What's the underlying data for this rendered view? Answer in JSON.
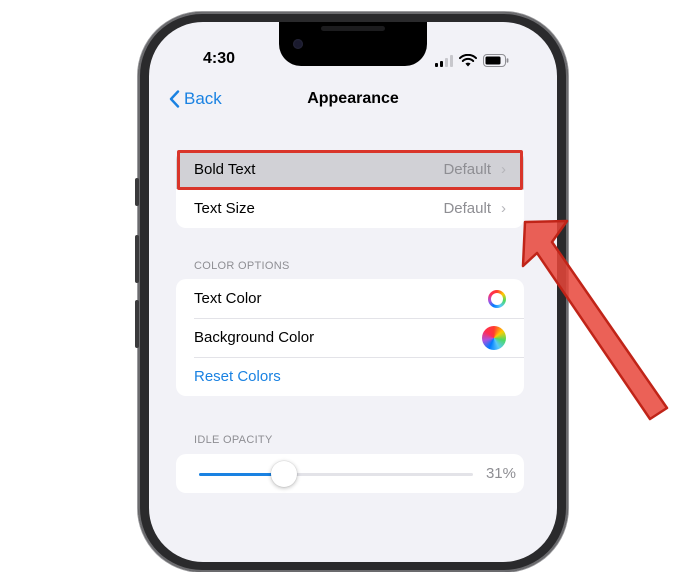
{
  "status_bar": {
    "time": "4:30"
  },
  "nav": {
    "back_label": "Back",
    "title": "Appearance"
  },
  "text_group": {
    "rows": [
      {
        "label": "Bold Text",
        "value": "Default"
      },
      {
        "label": "Text Size",
        "value": "Default"
      }
    ]
  },
  "color_options": {
    "header": "COLOR OPTIONS",
    "text_color_label": "Text Color",
    "background_color_label": "Background Color",
    "reset_label": "Reset Colors"
  },
  "idle_opacity": {
    "header": "IDLE OPACITY",
    "value_percent": 31,
    "value_label": "31%"
  },
  "colors": {
    "accent": "#1a82e2",
    "annotation_red": "#d9352a",
    "highlight_row": "#d1d1d6",
    "background": "#f2f2f7"
  },
  "icons": [
    "chevron-left-icon",
    "chevron-right-icon",
    "wifi-icon",
    "battery-icon",
    "cellular-signal-icon",
    "color-wheel-icon"
  ]
}
